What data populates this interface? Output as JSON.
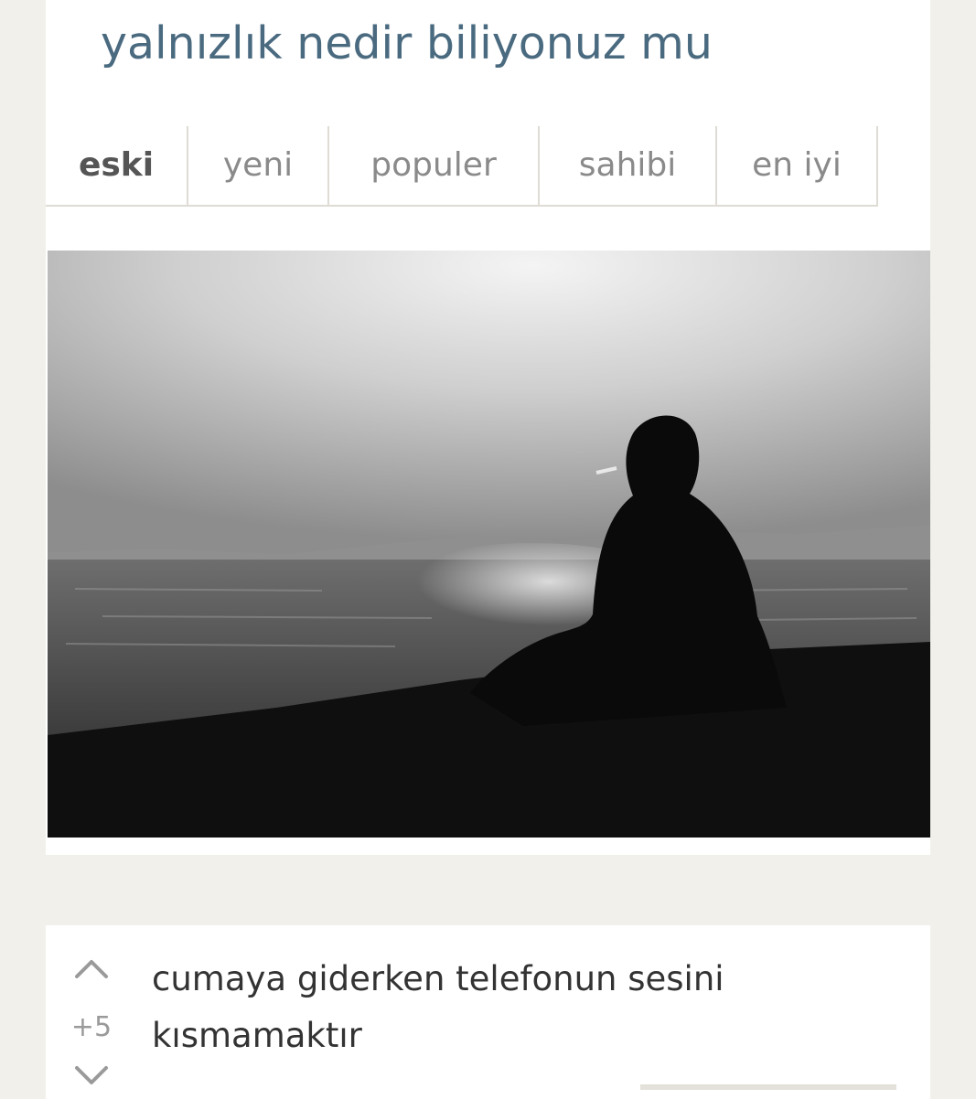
{
  "topic": {
    "title": "yalnızlık nedir biliyonuz mu"
  },
  "tabs": [
    {
      "label": "eski",
      "active": true
    },
    {
      "label": "yeni",
      "active": false
    },
    {
      "label": "populer",
      "active": false
    },
    {
      "label": "sahibi",
      "active": false
    },
    {
      "label": "en iyi",
      "active": false
    }
  ],
  "colors": {
    "title": "#4a6a80",
    "page_background": "#f2f0ea",
    "card_background": "#ffffff"
  },
  "entry": {
    "score": "+5",
    "text": "cumaya giderken telefonun sesini kısmamaktır"
  },
  "icons": {
    "vote_up": "chevron-up-icon",
    "vote_down": "chevron-down-icon"
  }
}
